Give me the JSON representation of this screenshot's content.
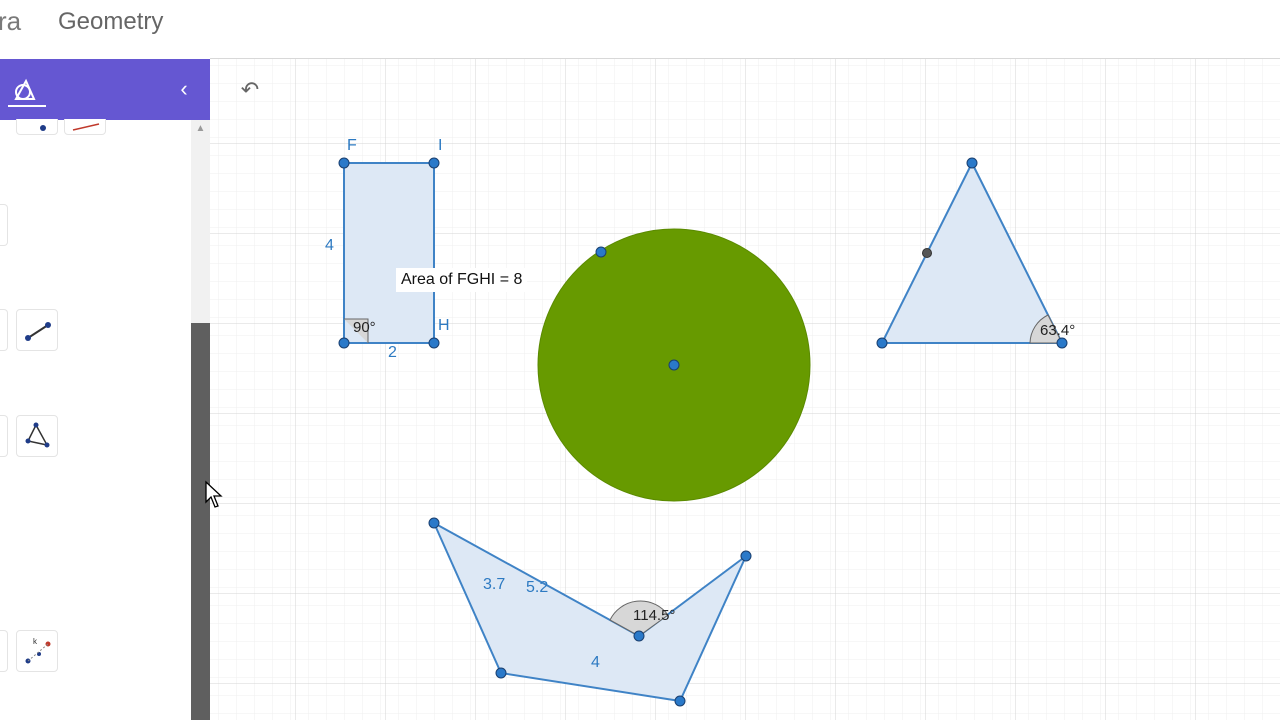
{
  "header": {
    "brand_partial": "ra",
    "title": "Geometry"
  },
  "panel": {
    "collapse_icon": "‹",
    "tools_icon": "geometry-tools-icon",
    "tools": [
      "point-icon",
      "segment-icon",
      "polygon-icon",
      "slider-point-icon"
    ]
  },
  "canvas": {
    "undo_icon": "↶",
    "colors": {
      "stroke": "#3f83c6",
      "fill": "#dde8f5",
      "circle": "#679a00",
      "point": "#2a79c9"
    },
    "rectangle": {
      "vertex_f": "F",
      "vertex_i": "I",
      "vertex_h": "H",
      "side_left": "4",
      "side_bottom": "2",
      "angle": "90°",
      "area_text": "Area of  FGHI = 8"
    },
    "triangle": {
      "angle": "63.4°"
    },
    "quadrilateral": {
      "side_a": "3.7",
      "side_b": "5.2",
      "side_c": "4",
      "angle": "114.5°"
    }
  }
}
